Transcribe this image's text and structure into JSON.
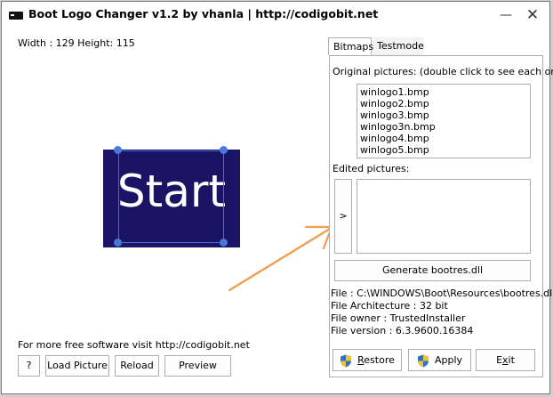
{
  "window": {
    "title": "Boot Logo Changer v1.2 by vhanla | http://codigobit.net",
    "minimize_glyph": "—",
    "close_glyph": "✕"
  },
  "left": {
    "dimensions": "Width : 129 Height: 115",
    "preview_text": "Start",
    "promo": "For more free software visit  http://codigobit.net",
    "buttons": {
      "help": "?",
      "load": "Load Picture",
      "reload": "Reload",
      "preview": "Preview"
    }
  },
  "tabs": [
    {
      "label": "Bitmaps",
      "active": true
    },
    {
      "label": "Testmode",
      "active": false
    }
  ],
  "bitmaps": {
    "original_label": "Original pictures: (double click to see each one)",
    "original_items": [
      "winlogo1.bmp",
      "winlogo2.bmp",
      "winlogo3.bmp",
      "winlogo3n.bmp",
      "winlogo4.bmp",
      "winlogo5.bmp"
    ],
    "edited_label": "Edited pictures:",
    "move_button": ">",
    "generate_button": "Generate bootres.dll",
    "file_info": [
      "File : C:\\WINDOWS\\Boot\\Resources\\bootres.dll",
      "File Architecture : 32 bit",
      "File owner : TrustedInstaller",
      "File version : 6.3.9600.16384"
    ],
    "restore_button": {
      "accel": "R",
      "rest": "estore"
    },
    "apply_button": "Apply",
    "exit_button": {
      "accel": "x",
      "pre": "E",
      "rest": "it"
    }
  },
  "colors": {
    "preview_bg": "#1b1464",
    "selection": "#3e6fd6",
    "arrow": "#f29b4b"
  },
  "icons": {
    "app": "app-icon",
    "shield": "uac-shield-icon",
    "arrow": "orange-annotation-arrow"
  }
}
